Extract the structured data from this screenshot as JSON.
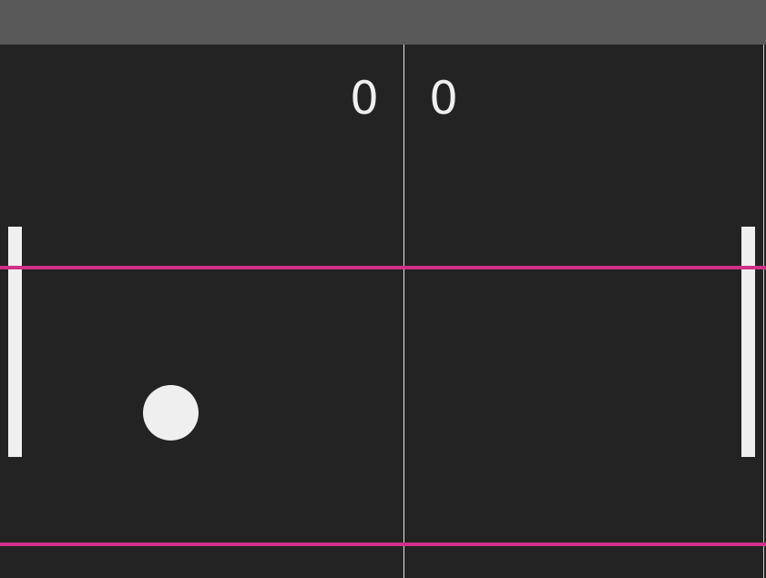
{
  "scoreboard": {
    "left_score": "0",
    "right_score": "0"
  },
  "colors": {
    "background": "#232323",
    "top_bar": "#595959",
    "foreground": "#efefef",
    "guide_line": "#d02f8a"
  },
  "icons": {
    "ball": "ball-icon",
    "left_paddle": "paddle-icon",
    "right_paddle": "paddle-icon"
  }
}
